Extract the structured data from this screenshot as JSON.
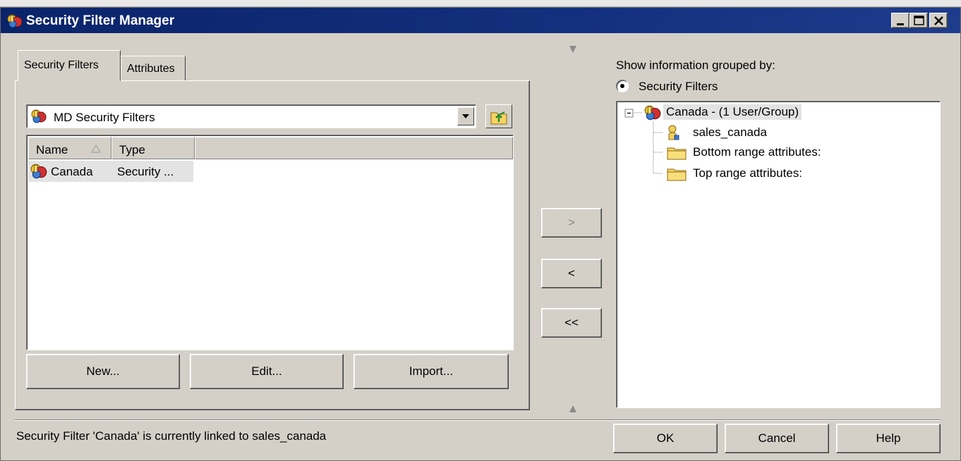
{
  "window": {
    "title": "Security Filter Manager",
    "title_color": "#0a246a",
    "caption_buttons": [
      "minimize",
      "maximize",
      "close"
    ]
  },
  "tabs": [
    {
      "label": "Security Filters",
      "active": true
    },
    {
      "label": "Attributes",
      "active": false
    }
  ],
  "filter_combo": {
    "value": "MD Security Filters",
    "icon": "security-filter-icon"
  },
  "list": {
    "columns": [
      {
        "label": "Name",
        "sorted": "ascending"
      },
      {
        "label": "Type"
      }
    ],
    "rows": [
      {
        "name": "Canada",
        "type": "Security ...",
        "icon": "security-filter-icon"
      }
    ]
  },
  "buttons": {
    "new": "New...",
    "edit": "Edit...",
    "import": "Import...",
    "move_right": ">",
    "move_left": "<",
    "move_all_left": "<<",
    "ok": "OK",
    "cancel": "Cancel",
    "help": "Help"
  },
  "right_panel": {
    "group_by_label": "Show information grouped by:",
    "radio_option": "Security Filters",
    "radio_selected": true,
    "tree": {
      "root": {
        "label": "Canada - (1 User/Group)",
        "expanded": true,
        "icon": "security-filter-icon"
      },
      "children": [
        {
          "label": "sales_canada",
          "icon": "user-icon"
        },
        {
          "label": "Bottom range attributes:",
          "icon": "folder-icon"
        },
        {
          "label": "Top range attributes:",
          "icon": "folder-icon"
        }
      ]
    }
  },
  "status_text": "Security Filter 'Canada' is currently linked to sales_canada"
}
